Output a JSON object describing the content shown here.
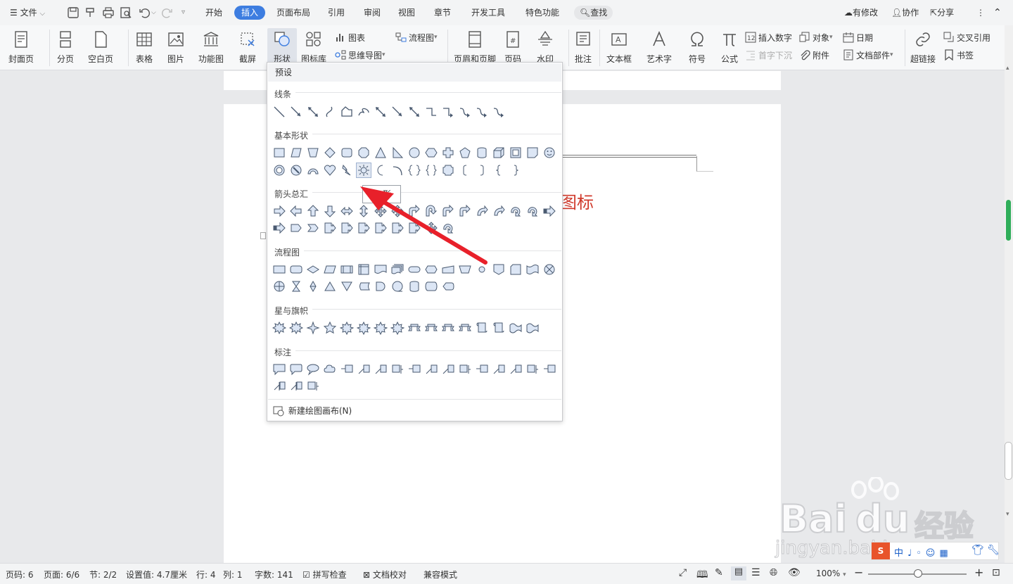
{
  "menubar": {
    "file": "文件",
    "tabs": [
      "开始",
      "插入",
      "页面布局",
      "引用",
      "审阅",
      "视图",
      "章节",
      "开发工具",
      "特色功能"
    ],
    "active_tab": "插入",
    "search": "查找",
    "right": [
      "有修改",
      "协作",
      "分享"
    ]
  },
  "ribbon": {
    "cover": "封面页",
    "pagebreak": "分页",
    "blank": "空白页",
    "table": "表格",
    "picture": "图片",
    "func": "功能图",
    "screenshot": "截屏",
    "shape": "形状",
    "iconlib": "图标库",
    "chart": "图表",
    "mindmap": "思维导图",
    "flowchart": "流程图",
    "headerfooter": "页眉和页脚",
    "pagenum": "页码",
    "watermark": "水印",
    "comment": "批注",
    "textbox": "文本框",
    "wordart": "艺术字",
    "symbol": "符号",
    "formula": "公式",
    "insertnum": "插入数字",
    "dropcap": "首字下沉",
    "object": "对象",
    "attach": "附件",
    "date": "日期",
    "docpart": "文档部件",
    "hyperlink": "超链接",
    "crossref": "交叉引用",
    "bookmark": "书签"
  },
  "document": {
    "visible_text": "图标"
  },
  "dropdown": {
    "header": "预设",
    "sections": [
      "线条",
      "基本形状",
      "箭头总汇",
      "流程图",
      "星与旗帜",
      "标注"
    ],
    "new_canvas": "新建绘图画布(N)"
  },
  "tooltip": "形",
  "statusbar": {
    "page": "页码: 6",
    "pages": "页面: 6/6",
    "section": "节: 2/2",
    "setting": "设置值: 4.7厘米",
    "row": "行: 4",
    "col": "列: 1",
    "words": "字数: 141",
    "spell": "拼写检查",
    "proof": "文档校对",
    "compat": "兼容模式",
    "zoom": "100%"
  },
  "watermark": {
    "brand": "Bai",
    "brand2": "du",
    "brand3": "经验",
    "url": "jingyan.baidu.com"
  },
  "colors": {
    "accent": "#3d7de0",
    "arrow": "#e8202a",
    "doc_red": "#d03a2c"
  }
}
